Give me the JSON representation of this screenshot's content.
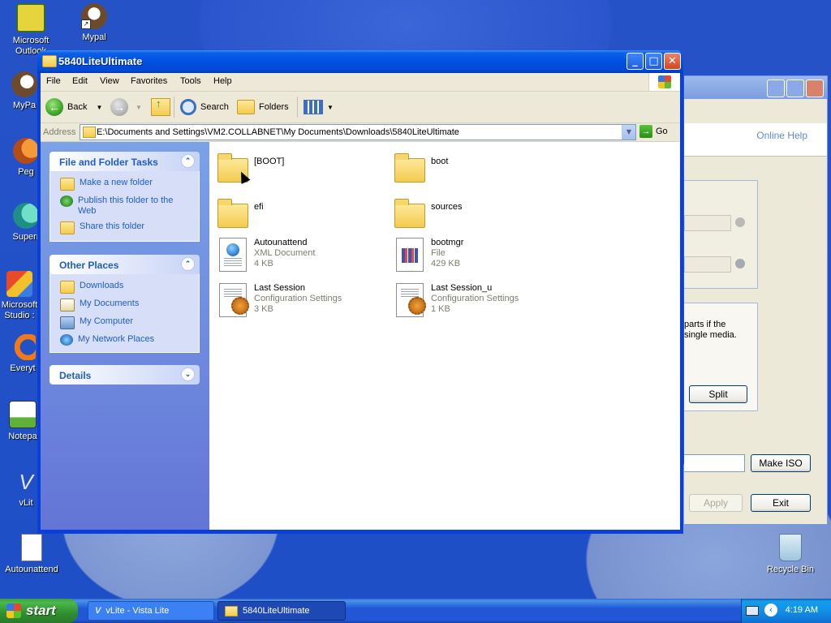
{
  "desktop": {
    "icons": [
      {
        "label": "Microsoft Outlook",
        "icon": "outlook-icon"
      },
      {
        "label": "Mypal",
        "icon": "mypal-icon"
      },
      {
        "label": "MyPa",
        "icon": "mypal-icon"
      },
      {
        "label": "Peg",
        "icon": "app-icon"
      },
      {
        "label": "Superr",
        "icon": "app-icon"
      },
      {
        "label": "Microsoft Studio :",
        "icon": "visual-studio-icon"
      },
      {
        "label": "Everyt",
        "icon": "everything-icon"
      },
      {
        "label": "Notepa",
        "icon": "notepad-icon"
      },
      {
        "label": "vLit",
        "icon": "vlite-icon"
      },
      {
        "label": "Autounattend",
        "icon": "xml-document-icon"
      },
      {
        "label": "Recycle Bin",
        "icon": "recycle-bin-icon"
      }
    ]
  },
  "background_window": {
    "online_help": "Online Help",
    "partial_text_line1": "parts if the",
    "partial_text_line2": "single media.",
    "split_label": "Split",
    "make_iso_label": "Make ISO",
    "apply_label": "Apply",
    "exit_label": "Exit"
  },
  "window": {
    "title": "5840LiteUltimate",
    "menu": [
      "File",
      "Edit",
      "View",
      "Favorites",
      "Tools",
      "Help"
    ],
    "toolbar": {
      "back": "Back",
      "search": "Search",
      "folders": "Folders"
    },
    "address": {
      "label": "Address",
      "path": "E:\\Documents and Settings\\VM2.COLLABNET\\My Documents\\Downloads\\5840LiteUltimate",
      "go": "Go"
    },
    "tasks": {
      "header": "File and Folder Tasks",
      "items": [
        {
          "label": "Make a new folder",
          "icon": "new-folder-icon"
        },
        {
          "label": "Publish this folder to the Web",
          "icon": "publish-web-icon"
        },
        {
          "label": "Share this folder",
          "icon": "share-folder-icon"
        }
      ]
    },
    "other_places": {
      "header": "Other Places",
      "items": [
        {
          "label": "Downloads",
          "icon": "folder-icon"
        },
        {
          "label": "My Documents",
          "icon": "my-documents-icon"
        },
        {
          "label": "My Computer",
          "icon": "my-computer-icon"
        },
        {
          "label": "My Network Places",
          "icon": "network-places-icon"
        }
      ]
    },
    "details": {
      "header": "Details"
    },
    "files": [
      {
        "name": "[BOOT]",
        "type": "folder"
      },
      {
        "name": "boot",
        "type": "folder"
      },
      {
        "name": "efi",
        "type": "folder"
      },
      {
        "name": "sources",
        "type": "folder"
      },
      {
        "name": "Autounattend",
        "kind": "XML Document",
        "size": "4 KB",
        "type": "xml"
      },
      {
        "name": "bootmgr",
        "kind": "File",
        "size": "429 KB",
        "type": "file"
      },
      {
        "name": "Last Session",
        "kind": "Configuration Settings",
        "size": "3 KB",
        "type": "config"
      },
      {
        "name": "Last Session_u",
        "kind": "Configuration Settings",
        "size": "1 KB",
        "type": "config"
      }
    ]
  },
  "taskbar": {
    "start": "start",
    "items": [
      {
        "label": "vLite - Vista Lite",
        "active": false
      },
      {
        "label": "5840LiteUltimate",
        "active": true
      }
    ],
    "clock": "4:19 AM"
  }
}
